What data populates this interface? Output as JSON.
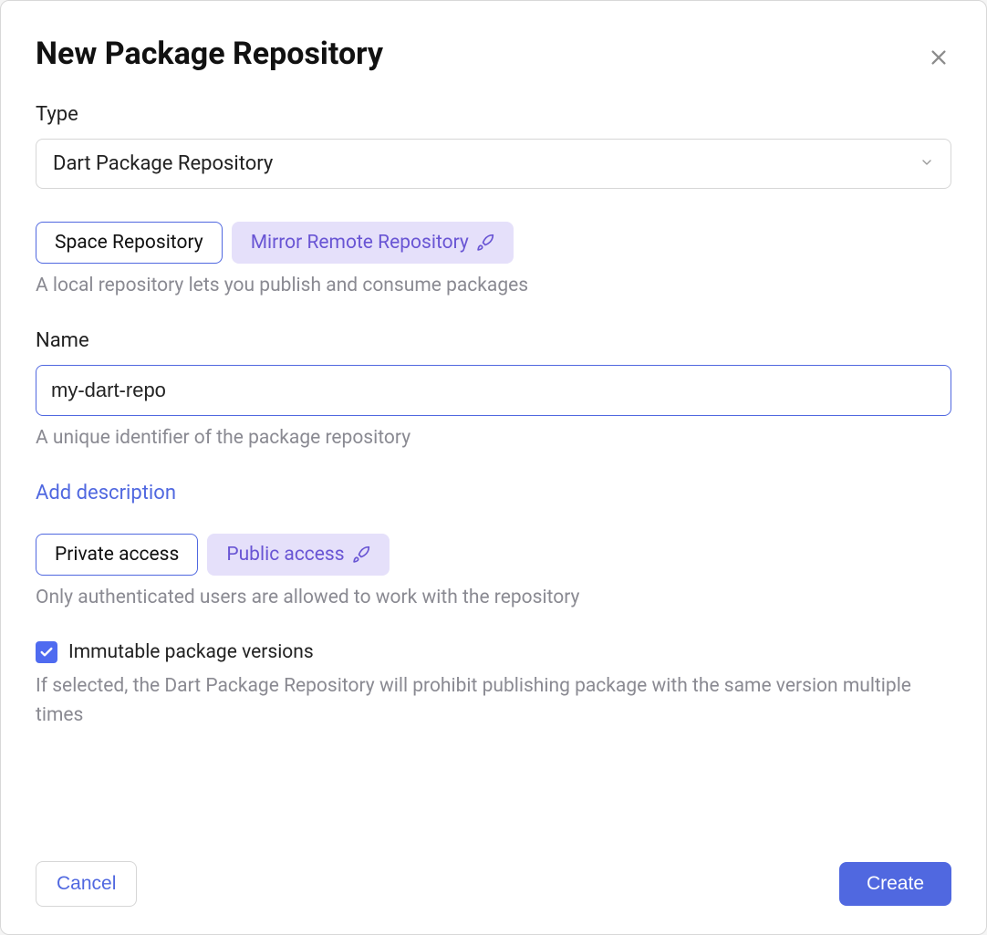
{
  "modal": {
    "title": "New Package Repository"
  },
  "type": {
    "label": "Type",
    "selected": "Dart Package Repository"
  },
  "repo_mode": {
    "space": "Space Repository",
    "mirror": "Mirror Remote Repository",
    "helper": "A local repository lets you publish and consume packages"
  },
  "name": {
    "label": "Name",
    "value": "my-dart-repo",
    "helper": "A unique identifier of the package repository"
  },
  "description": {
    "add_link": "Add description"
  },
  "access": {
    "private": "Private access",
    "public": "Public access",
    "helper": "Only authenticated users are allowed to work with the repository"
  },
  "immutable": {
    "label": "Immutable package versions",
    "checked": true,
    "helper": "If selected, the Dart Package Repository will prohibit publishing package with the same version multiple times"
  },
  "footer": {
    "cancel": "Cancel",
    "create": "Create"
  }
}
